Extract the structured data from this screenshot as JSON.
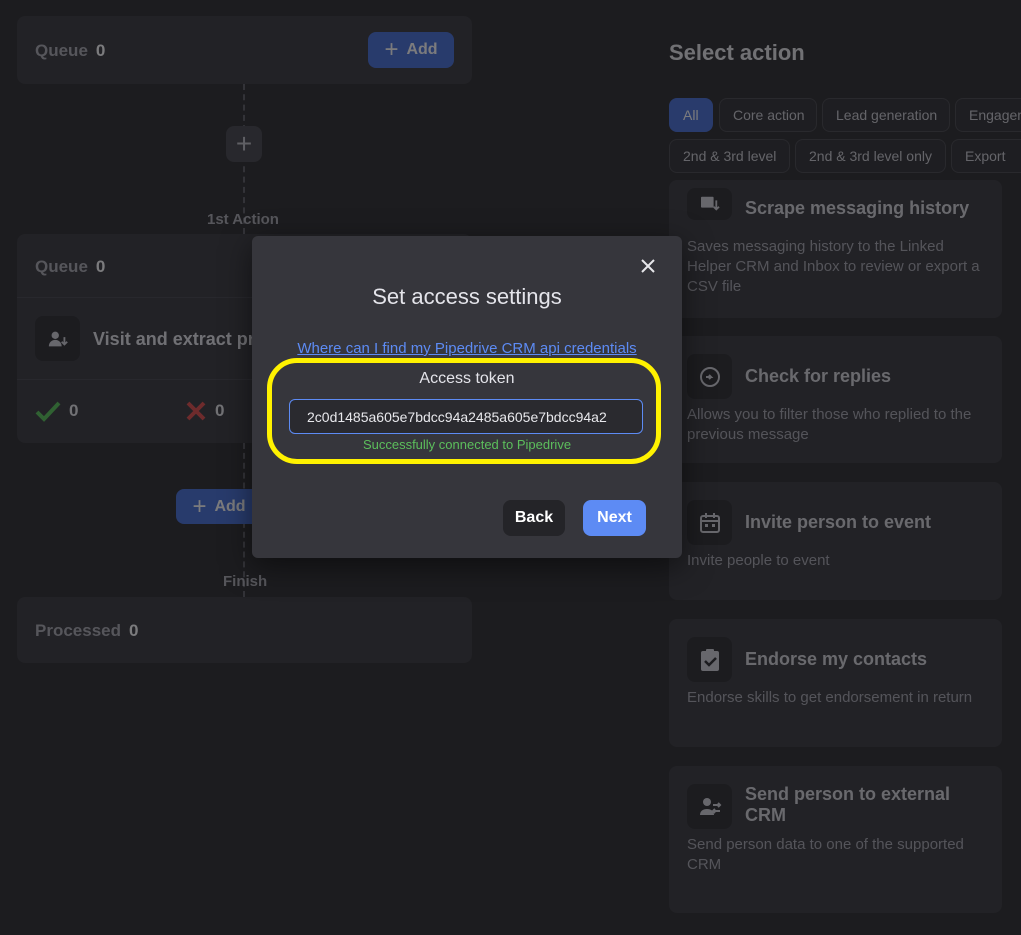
{
  "workflow": {
    "queue_top": {
      "label": "Queue",
      "count": "0",
      "add_label": "Add"
    },
    "first_action_label": "1st Action",
    "action_block": {
      "queue_label": "Queue",
      "queue_count": "0",
      "action_name": "Visit and extract pr",
      "success_count": "0",
      "fail_count": "0",
      "add_label": "Add"
    },
    "finish_label": "Finish",
    "processed": {
      "label": "Processed",
      "count": "0"
    }
  },
  "right_panel": {
    "title": "Select action",
    "filters_row1": [
      "All",
      "Core action",
      "Lead generation",
      "Engagement"
    ],
    "filters_row2": [
      "2nd & 3rd level",
      "2nd & 3rd level only",
      "Export"
    ],
    "actions": [
      {
        "title": "Scrape messaging history",
        "desc": "Saves messaging history to the Linked Helper CRM and Inbox to review or export a CSV file",
        "icon": "scrape-history-icon"
      },
      {
        "title": "Check for replies",
        "desc": "Allows you to filter those who replied to the previous message",
        "icon": "replies-icon"
      },
      {
        "title": "Invite person to event",
        "desc": "Invite people to event",
        "icon": "calendar-icon"
      },
      {
        "title": "Endorse my contacts",
        "desc": "Endorse skills to get endorsement in return",
        "icon": "clipboard-check-icon"
      },
      {
        "title": "Send person to external CRM",
        "desc": "Send person data to one of the supported CRM",
        "icon": "person-transfer-icon"
      }
    ]
  },
  "modal": {
    "title": "Set access settings",
    "help_link": "Where can I find my Pipedrive CRM api credentials",
    "token_label": "Access token",
    "token_value": "2c0d1485a605e7bdcc94a2485a605e7bdcc94a2",
    "success_text": "Successfully connected to Pipedrive",
    "back_label": "Back",
    "next_label": "Next"
  },
  "colors": {
    "accent": "#5d8bf4",
    "highlight": "#fff200",
    "success": "#5cbe5c",
    "danger": "#e0413f"
  }
}
